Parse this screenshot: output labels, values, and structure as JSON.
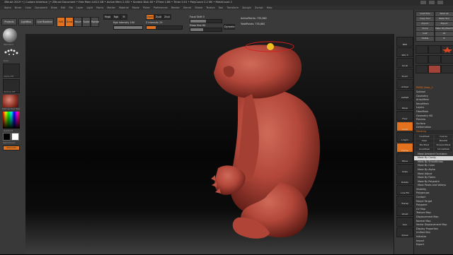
{
  "window": {
    "title": "ZBrush 2019 • [ Custom Interface ] • ZBrush Document • Free Mem 4.612 GB • Active Mem 2.032 • Scratch Disk 48 • ZTime 1.86 • Timer 0.01 • PolyCount 2.2 Mil • MeshCount 1"
  },
  "menubar": {
    "items": [
      "Alpha",
      "Brush",
      "Color",
      "Document",
      "Draw",
      "Edit",
      "File",
      "Layer",
      "Light",
      "Macro",
      "Marker",
      "Material",
      "Movie",
      "Picker",
      "Preferences",
      "Render",
      "Stencil",
      "Stroke",
      "Texture",
      "Tool",
      "Transform",
      "Zplugin",
      "Zscript",
      "Help"
    ]
  },
  "toolbar": {
    "projects": "Projects",
    "lightbox": "LightBox",
    "live_boolean": "Live Boolean",
    "edit": "Edit",
    "draw": "Draw",
    "move": "Move",
    "scale": "Scale",
    "rotate": "Rotate",
    "mrgb": "Mrgb",
    "rgb": "Rgb",
    "m": "M",
    "zadd": "Zadd",
    "zsub": "Zsub",
    "zcut": "Zcut",
    "rgb_intensity": "Rgb Intensity 100",
    "z_intensity": "Z Intensity 25",
    "focal_shift": "Focal Shift 0",
    "draw_size": "Draw Size 64",
    "dynamic": "Dynamic",
    "active_points": "ActivePoints: 735,862",
    "total_points": "TotalPoints: 735,862",
    "rgb_value": 1.0,
    "z_value": 0.25,
    "focal_value": 0.5,
    "draw_value": 0.4
  },
  "left_shelf": {
    "brush_label": "Standard",
    "stroke_label": "Dots",
    "alpha_label": "Alpha Off",
    "texture_label": "Texture Off",
    "material_label": "MatCap Red Wax",
    "gradient_label": "Gradient",
    "switch_label": "SwitchColor",
    "alternate_label": "Alternate"
  },
  "right_shelf": {
    "items": [
      "BPR",
      "SPix 3",
      "Scroll",
      "Zoom",
      "Actual",
      "AAHalf",
      "Persp",
      "Floor",
      "Local",
      "L.Sym",
      "Frame",
      "Move",
      "Scale",
      "Rotate",
      "Line Fill",
      "Transp",
      "Ghost",
      "Solo",
      "Xpose"
    ]
  },
  "right_tray": {
    "top_buttons": [
      "Load Tool",
      "Save As",
      "Copy Tool",
      "Paste Tool",
      "Import",
      "Export",
      "Clone",
      "Make PolyMesh3D",
      "GoZ",
      "All",
      "Visible",
      "R"
    ],
    "tool_name": "PM3D_Baby_1",
    "tool_count": "48",
    "sections": [
      "Subtool",
      "Geometry",
      "ArrayMesh",
      "NanoMesh",
      "Layers",
      "FiberMesh",
      "Geometry HD",
      "Preview",
      "Surface",
      "Deformation",
      "Masking",
      "Visibility",
      "Polygroups",
      "Contact",
      "Morph Target",
      "Polypaint",
      "UV Map",
      "Texture Map",
      "Displacement Map",
      "Normal Map",
      "Vector Displacement Map",
      "Display Properties",
      "Unified Skin",
      "Initialize",
      "Import",
      "Export"
    ],
    "mask_buttons": [
      "ViewMask",
      "Inverse",
      "Clear",
      "MaskAll",
      "BlurMask",
      "SharpenMask",
      "GrowMask",
      "ShrinkMask"
    ],
    "mask_items": [
      "Mask Ambient Occlusion",
      "Mask By Cavity",
      "Mask By Smoothness",
      "Mask By Color",
      "Mask By Alpha",
      "Mask Adjust",
      "Mask By Fibers",
      "Mask By Polypaint",
      "Mask Peaks and Valleys"
    ],
    "mask_highlight": "Mask By Cavity",
    "bottom_items": [
      "Visibility",
      "Polygroups",
      "Contact",
      "Morph Target",
      "Polypaint"
    ]
  },
  "colors": {
    "accent": "#e2721d",
    "model": "#b2473a",
    "panel": "#393939",
    "canvas_top": "#1e1e1e"
  }
}
